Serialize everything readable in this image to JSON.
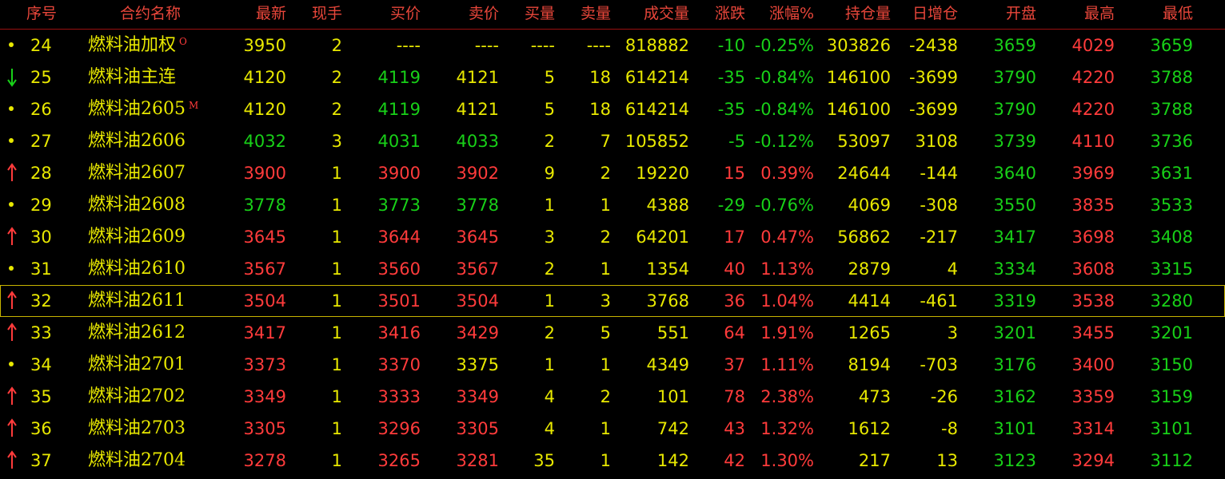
{
  "colors": {
    "up": "#ff3b3b",
    "down": "#18d018",
    "flat": "#e8e800",
    "header": "#e8463a",
    "bg": "#000000"
  },
  "header": {
    "seq": "序号",
    "name": "合约名称",
    "last": "最新",
    "cur_vol": "现手",
    "bid": "买价",
    "ask": "卖价",
    "bid_vol": "买量",
    "ask_vol": "卖量",
    "volume": "成交量",
    "change": "涨跌",
    "change_pct": "涨幅%",
    "open_interest": "持仓量",
    "oi_change": "日增仓",
    "open": "开盘",
    "high": "最高",
    "low": "最低"
  },
  "rows": [
    {
      "icon": "dot",
      "seq": "24",
      "name": "燃料油加权",
      "mark": "O",
      "last": "3950",
      "cur": "2",
      "bid": "----",
      "ask": "----",
      "bidv": "----",
      "askv": "----",
      "vol": "818882",
      "chg": "-10",
      "pct": "-0.25%",
      "oi": "303826",
      "oic": "-2438",
      "open": "3659",
      "high": "4029",
      "low": "3659",
      "c": {
        "last": "flat",
        "bid": "flat",
        "ask": "flat",
        "chg": "down",
        "pct": "down",
        "open": "down",
        "high": "up",
        "low": "down"
      }
    },
    {
      "icon": "down",
      "seq": "25",
      "name": "燃料油主连",
      "mark": "",
      "last": "4120",
      "cur": "2",
      "bid": "4119",
      "ask": "4121",
      "bidv": "5",
      "askv": "18",
      "vol": "614214",
      "chg": "-35",
      "pct": "-0.84%",
      "oi": "146100",
      "oic": "-3699",
      "open": "3790",
      "high": "4220",
      "low": "3788",
      "c": {
        "last": "flat",
        "bid": "down",
        "ask": "flat",
        "chg": "down",
        "pct": "down",
        "open": "down",
        "high": "up",
        "low": "down"
      }
    },
    {
      "icon": "dot",
      "seq": "26",
      "name": "燃料油2605",
      "mark": "M",
      "last": "4120",
      "cur": "2",
      "bid": "4119",
      "ask": "4121",
      "bidv": "5",
      "askv": "18",
      "vol": "614214",
      "chg": "-35",
      "pct": "-0.84%",
      "oi": "146100",
      "oic": "-3699",
      "open": "3790",
      "high": "4220",
      "low": "3788",
      "c": {
        "last": "flat",
        "bid": "down",
        "ask": "flat",
        "chg": "down",
        "pct": "down",
        "open": "down",
        "high": "up",
        "low": "down"
      }
    },
    {
      "icon": "dot",
      "seq": "27",
      "name": "燃料油2606",
      "mark": "",
      "last": "4032",
      "cur": "3",
      "bid": "4031",
      "ask": "4033",
      "bidv": "2",
      "askv": "7",
      "vol": "105852",
      "chg": "-5",
      "pct": "-0.12%",
      "oi": "53097",
      "oic": "3108",
      "open": "3739",
      "high": "4110",
      "low": "3736",
      "c": {
        "last": "down",
        "bid": "down",
        "ask": "down",
        "chg": "down",
        "pct": "down",
        "open": "down",
        "high": "up",
        "low": "down"
      }
    },
    {
      "icon": "up",
      "seq": "28",
      "name": "燃料油2607",
      "mark": "",
      "last": "3900",
      "cur": "1",
      "bid": "3900",
      "ask": "3902",
      "bidv": "9",
      "askv": "2",
      "vol": "19220",
      "chg": "15",
      "pct": "0.39%",
      "oi": "24644",
      "oic": "-144",
      "open": "3640",
      "high": "3969",
      "low": "3631",
      "c": {
        "last": "up",
        "bid": "up",
        "ask": "up",
        "chg": "up",
        "pct": "up",
        "open": "down",
        "high": "up",
        "low": "down"
      }
    },
    {
      "icon": "dot",
      "seq": "29",
      "name": "燃料油2608",
      "mark": "",
      "last": "3778",
      "cur": "1",
      "bid": "3773",
      "ask": "3778",
      "bidv": "1",
      "askv": "1",
      "vol": "4388",
      "chg": "-29",
      "pct": "-0.76%",
      "oi": "4069",
      "oic": "-308",
      "open": "3550",
      "high": "3835",
      "low": "3533",
      "c": {
        "last": "down",
        "bid": "down",
        "ask": "down",
        "chg": "down",
        "pct": "down",
        "open": "down",
        "high": "up",
        "low": "down"
      }
    },
    {
      "icon": "up",
      "seq": "30",
      "name": "燃料油2609",
      "mark": "",
      "last": "3645",
      "cur": "1",
      "bid": "3644",
      "ask": "3645",
      "bidv": "3",
      "askv": "2",
      "vol": "64201",
      "chg": "17",
      "pct": "0.47%",
      "oi": "56862",
      "oic": "-217",
      "open": "3417",
      "high": "3698",
      "low": "3408",
      "c": {
        "last": "up",
        "bid": "up",
        "ask": "up",
        "chg": "up",
        "pct": "up",
        "open": "down",
        "high": "up",
        "low": "down"
      }
    },
    {
      "icon": "dot",
      "seq": "31",
      "name": "燃料油2610",
      "mark": "",
      "last": "3567",
      "cur": "1",
      "bid": "3560",
      "ask": "3567",
      "bidv": "2",
      "askv": "1",
      "vol": "1354",
      "chg": "40",
      "pct": "1.13%",
      "oi": "2879",
      "oic": "4",
      "open": "3334",
      "high": "3608",
      "low": "3315",
      "c": {
        "last": "up",
        "bid": "up",
        "ask": "up",
        "chg": "up",
        "pct": "up",
        "open": "down",
        "high": "up",
        "low": "down"
      }
    },
    {
      "icon": "up",
      "seq": "32",
      "name": "燃料油2611",
      "mark": "",
      "last": "3504",
      "cur": "1",
      "bid": "3501",
      "ask": "3504",
      "bidv": "1",
      "askv": "3",
      "vol": "3768",
      "chg": "36",
      "pct": "1.04%",
      "oi": "4414",
      "oic": "-461",
      "open": "3319",
      "high": "3538",
      "low": "3280",
      "selected": true,
      "c": {
        "last": "up",
        "bid": "up",
        "ask": "up",
        "chg": "up",
        "pct": "up",
        "open": "down",
        "high": "up",
        "low": "down"
      }
    },
    {
      "icon": "up",
      "seq": "33",
      "name": "燃料油2612",
      "mark": "",
      "last": "3417",
      "cur": "1",
      "bid": "3416",
      "ask": "3429",
      "bidv": "2",
      "askv": "5",
      "vol": "551",
      "chg": "64",
      "pct": "1.91%",
      "oi": "1265",
      "oic": "3",
      "open": "3201",
      "high": "3455",
      "low": "3201",
      "c": {
        "last": "up",
        "bid": "up",
        "ask": "up",
        "chg": "up",
        "pct": "up",
        "open": "down",
        "high": "up",
        "low": "down"
      }
    },
    {
      "icon": "dot",
      "seq": "34",
      "name": "燃料油2701",
      "mark": "",
      "last": "3373",
      "cur": "1",
      "bid": "3370",
      "ask": "3375",
      "bidv": "1",
      "askv": "1",
      "vol": "4349",
      "chg": "37",
      "pct": "1.11%",
      "oi": "8194",
      "oic": "-703",
      "open": "3176",
      "high": "3400",
      "low": "3150",
      "c": {
        "last": "up",
        "bid": "up",
        "ask": "flat",
        "chg": "up",
        "pct": "up",
        "open": "down",
        "high": "up",
        "low": "down"
      }
    },
    {
      "icon": "up",
      "seq": "35",
      "name": "燃料油2702",
      "mark": "",
      "last": "3349",
      "cur": "1",
      "bid": "3333",
      "ask": "3349",
      "bidv": "4",
      "askv": "2",
      "vol": "101",
      "chg": "78",
      "pct": "2.38%",
      "oi": "473",
      "oic": "-26",
      "open": "3162",
      "high": "3359",
      "low": "3159",
      "c": {
        "last": "up",
        "bid": "up",
        "ask": "up",
        "chg": "up",
        "pct": "up",
        "open": "down",
        "high": "up",
        "low": "down"
      }
    },
    {
      "icon": "up",
      "seq": "36",
      "name": "燃料油2703",
      "mark": "",
      "last": "3305",
      "cur": "1",
      "bid": "3296",
      "ask": "3305",
      "bidv": "4",
      "askv": "1",
      "vol": "742",
      "chg": "43",
      "pct": "1.32%",
      "oi": "1612",
      "oic": "-8",
      "open": "3101",
      "high": "3314",
      "low": "3101",
      "c": {
        "last": "up",
        "bid": "up",
        "ask": "up",
        "chg": "up",
        "pct": "up",
        "open": "down",
        "high": "up",
        "low": "down"
      }
    },
    {
      "icon": "up",
      "seq": "37",
      "name": "燃料油2704",
      "mark": "",
      "last": "3278",
      "cur": "1",
      "bid": "3265",
      "ask": "3281",
      "bidv": "35",
      "askv": "1",
      "vol": "142",
      "chg": "42",
      "pct": "1.30%",
      "oi": "217",
      "oic": "13",
      "open": "3123",
      "high": "3294",
      "low": "3112",
      "c": {
        "last": "up",
        "bid": "up",
        "ask": "up",
        "chg": "up",
        "pct": "up",
        "open": "down",
        "high": "up",
        "low": "down"
      }
    }
  ]
}
